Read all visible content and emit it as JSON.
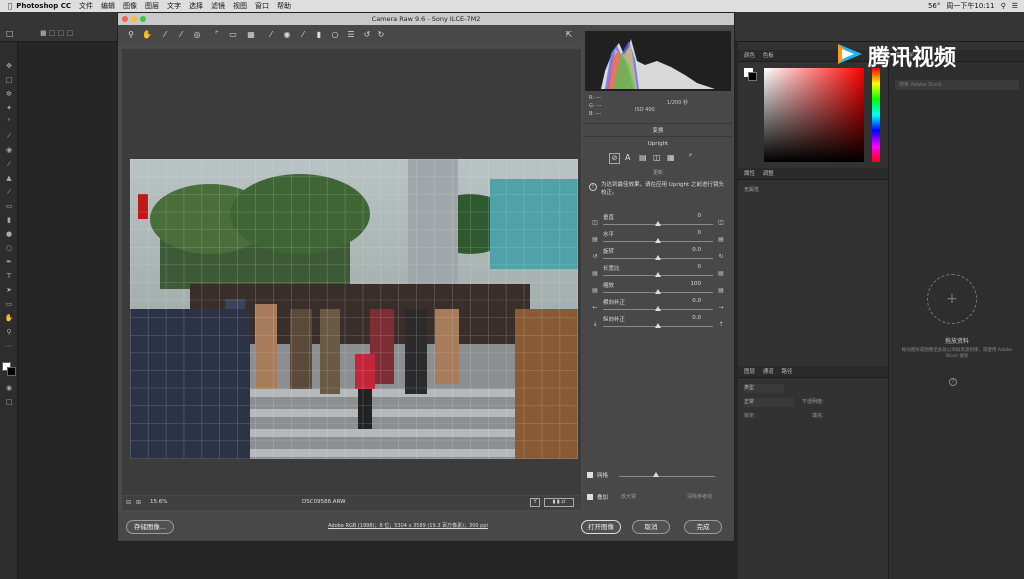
{
  "menubar": {
    "apple": "",
    "app": "Photoshop CC",
    "items": [
      "文件",
      "编辑",
      "图像",
      "图层",
      "文字",
      "选择",
      "滤镜",
      "视图",
      "窗口",
      "帮助"
    ],
    "right": {
      "temp": "56°",
      "clock": "周一下午10:11"
    }
  },
  "dialog": {
    "title": "Camera Raw 9.6  -  Sony ILCE-7M2",
    "zoom": "15.6%",
    "filename": "DSC09586.ARW",
    "histogram_info": {
      "exposure": "1/200 秒",
      "iso": "ISO 400",
      "r": "---",
      "g": "---",
      "b": "---"
    },
    "section_title": "变换",
    "upright_label": "Upright",
    "guides_label": "更新",
    "note": "为达到最佳效果，请在应用 Upright 之前进行镜头校正。",
    "sliders": [
      {
        "label": "垂直",
        "value": "0",
        "pos": 0.5
      },
      {
        "label": "水平",
        "value": "0",
        "pos": 0.5
      },
      {
        "label": "旋转",
        "value": "0.0",
        "pos": 0.5
      },
      {
        "label": "长宽比",
        "value": "0",
        "pos": 0.5
      },
      {
        "label": "缩放",
        "value": "100",
        "pos": 0.5
      },
      {
        "label": "横向补正",
        "value": "0.0",
        "pos": 0.5
      },
      {
        "label": "纵向补正",
        "value": "0.0",
        "pos": 0.5
      }
    ],
    "grid_label": "网格",
    "overlay_label": "叠加",
    "loupe_label": "放大镜",
    "clear_label": "清除参考线",
    "workflow_link": "Adobe RGB (1998)；8 位；5304 x 3589 (19.3 百万像素)；300 ppi",
    "save_button": "存储图像...",
    "open_button": "打开图像",
    "cancel_button": "取消",
    "done_button": "完成"
  },
  "panels": {
    "color_tab": "颜色",
    "swatch_tab": "色板",
    "lib_tab": "库",
    "learn_tab": "学习",
    "adjust_tabs": [
      "属性",
      "调整"
    ],
    "adjust_placeholder": "无属性",
    "layers_tabs": [
      "图层",
      "通道",
      "路径"
    ],
    "layers_kind": "类型",
    "layers_blend": "正常",
    "layers_opacity_label": "不透明度:",
    "layers_lock_label": "锁定:",
    "layers_fill_label": "填充:",
    "library_title": "拖放资料",
    "library_desc": "拖动图形或图像至此处以添加资源到库，或使用 Adobe Stock 搜索",
    "library_search": "搜索 Adobe Stock"
  },
  "watermark": "腾讯视频",
  "colors": {
    "accent": "#2a7bd9",
    "dialog": "#4a4a4a"
  }
}
